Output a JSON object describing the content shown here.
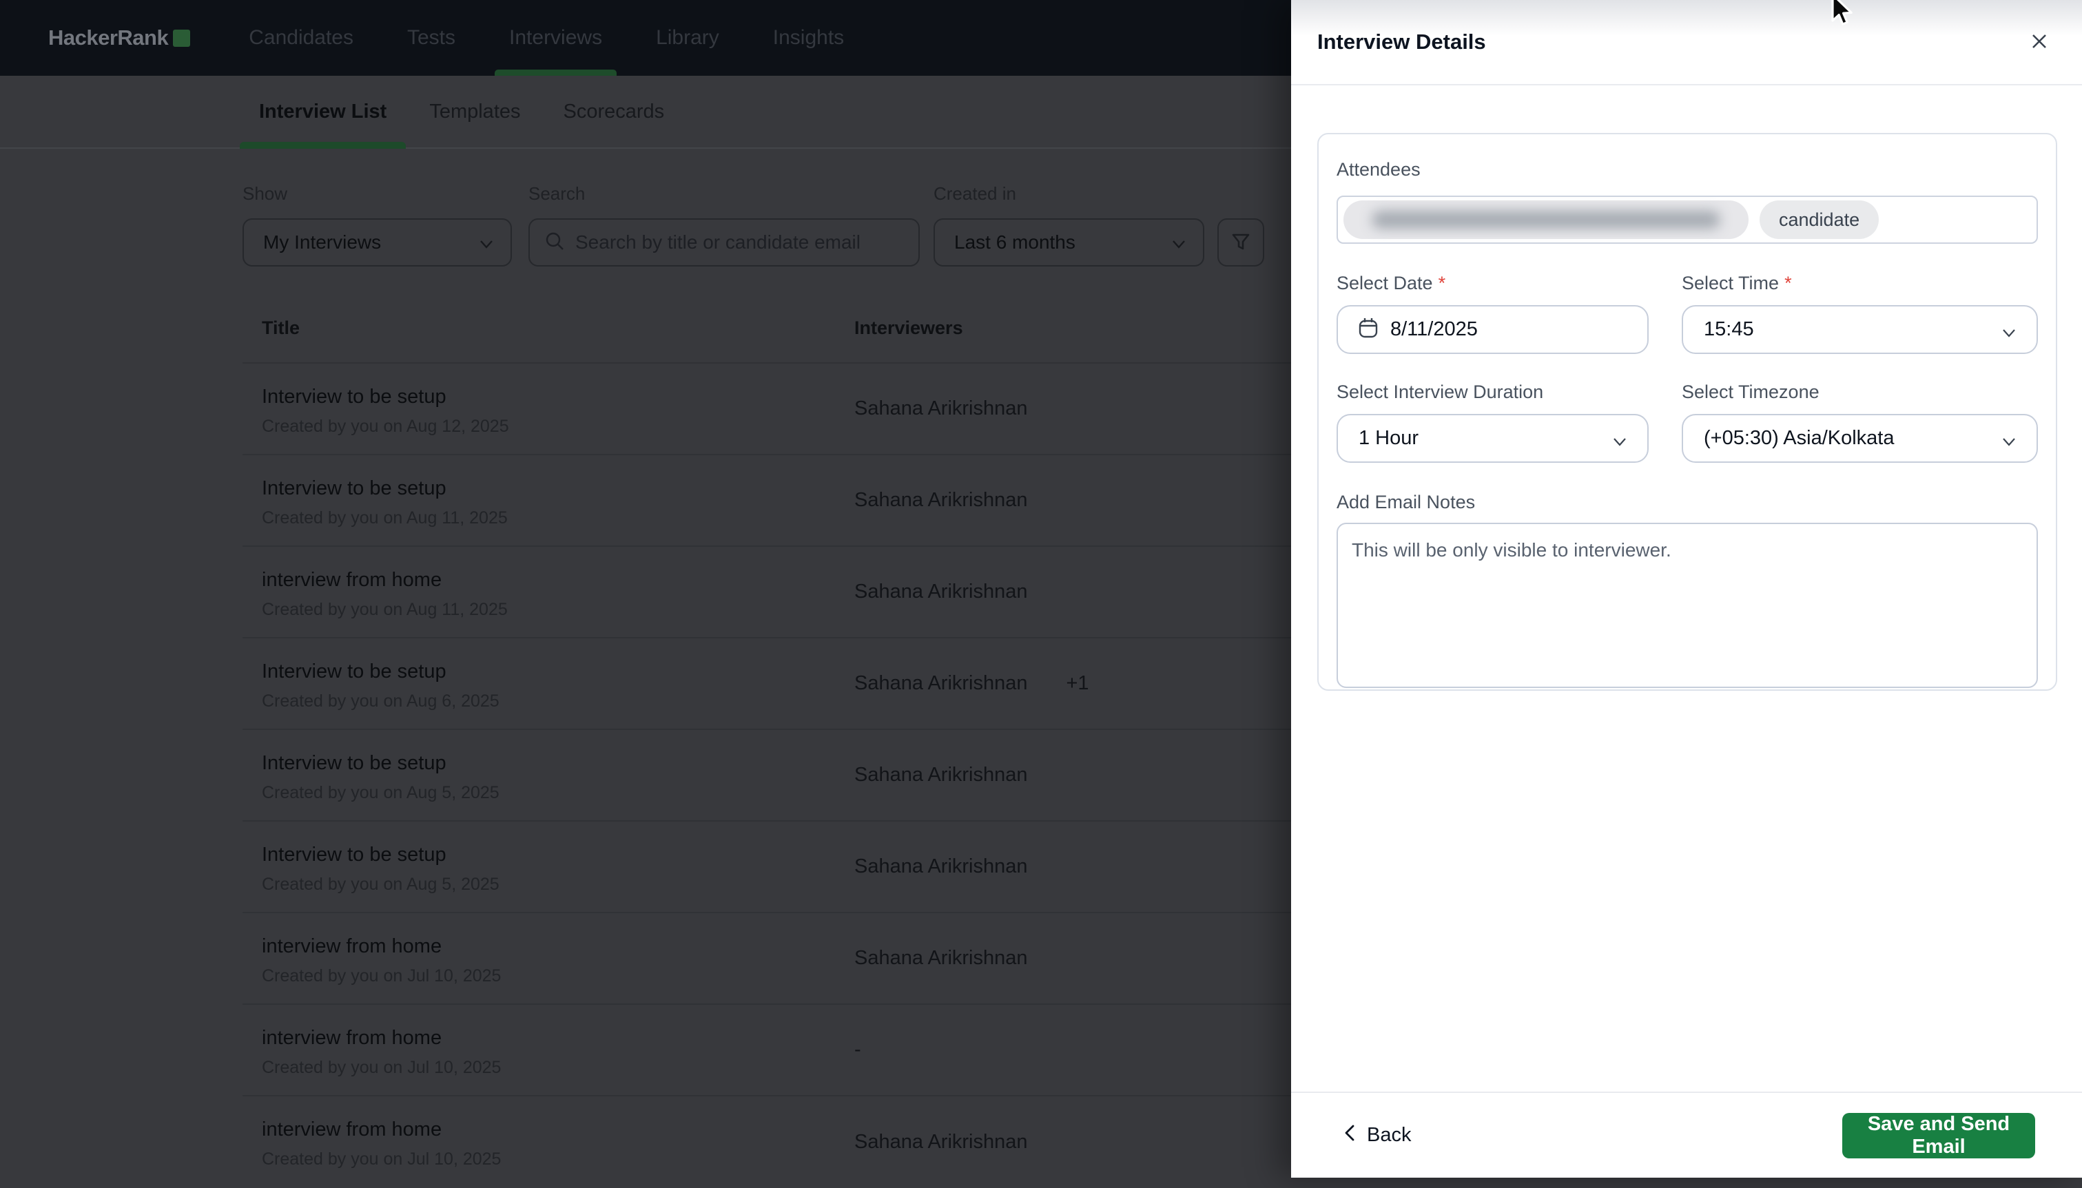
{
  "colors": {
    "brand_green": "#1ba94c",
    "save_button_green": "#188042",
    "required_red": "#e0443b",
    "navbar_bg": "#0d1117",
    "drawer_bg": "#ffffff"
  },
  "nav": {
    "logo_text": "HackerRank",
    "logo_icon": "green-square",
    "items": [
      {
        "label": "Candidates",
        "active": false
      },
      {
        "label": "Tests",
        "active": false
      },
      {
        "label": "Interviews",
        "active": true
      },
      {
        "label": "Library",
        "active": false
      },
      {
        "label": "Insights",
        "active": false
      }
    ]
  },
  "tabs": [
    {
      "label": "Interview List",
      "active": true
    },
    {
      "label": "Templates",
      "active": false
    },
    {
      "label": "Scorecards",
      "active": false
    }
  ],
  "filters": {
    "show": {
      "label": "Show",
      "value": "My Interviews"
    },
    "search": {
      "label": "Search",
      "placeholder": "Search by title or candidate email",
      "icon": "search-icon"
    },
    "created_in": {
      "label": "Created in",
      "value": "Last 6 months"
    },
    "filter_button_icon": "funnel-icon"
  },
  "table": {
    "columns": {
      "title": "Title",
      "interviewers": "Interviewers"
    },
    "rows": [
      {
        "title": "Interview to be setup",
        "created": "Created by you on Aug 12, 2025",
        "interviewer": "Sahana Arikrishnan",
        "extra": ""
      },
      {
        "title": "Interview to be setup",
        "created": "Created by you on Aug 11, 2025",
        "interviewer": "Sahana Arikrishnan",
        "extra": ""
      },
      {
        "title": "interview from home",
        "created": "Created by you on Aug 11, 2025",
        "interviewer": "Sahana Arikrishnan",
        "extra": ""
      },
      {
        "title": "Interview to be setup",
        "created": "Created by you on Aug 6, 2025",
        "interviewer": "Sahana Arikrishnan",
        "extra": "+1"
      },
      {
        "title": "Interview to be setup",
        "created": "Created by you on Aug 5, 2025",
        "interviewer": "Sahana Arikrishnan",
        "extra": ""
      },
      {
        "title": "Interview to be setup",
        "created": "Created by you on Aug 5, 2025",
        "interviewer": "Sahana Arikrishnan",
        "extra": ""
      },
      {
        "title": "interview from home",
        "created": "Created by you on Jul 10, 2025",
        "interviewer": "Sahana Arikrishnan",
        "extra": ""
      },
      {
        "title": "interview from home",
        "created": "Created by you on Jul 10, 2025",
        "interviewer": "-",
        "extra": ""
      },
      {
        "title": "interview from home",
        "created": "Created by you on Jul 10, 2025",
        "interviewer": "Sahana Arikrishnan",
        "extra": ""
      }
    ]
  },
  "drawer": {
    "title": "Interview Details",
    "close_icon": "close-icon",
    "required_marker": "*",
    "attendees": {
      "label": "Attendees",
      "chips": [
        {
          "type": "email",
          "blurred": true,
          "label": ""
        },
        {
          "type": "tag",
          "label": "candidate"
        }
      ]
    },
    "date": {
      "label": "Select Date",
      "required": true,
      "value": "8/11/2025",
      "icon": "calendar-icon"
    },
    "time": {
      "label": "Select Time",
      "required": true,
      "value": "15:45",
      "icon": "chevron-down-icon"
    },
    "duration": {
      "label": "Select Interview Duration",
      "value": "1 Hour",
      "icon": "chevron-down-icon"
    },
    "timezone": {
      "label": "Select Timezone",
      "value": "(+05:30) Asia/Kolkata",
      "icon": "chevron-down-icon"
    },
    "notes": {
      "label": "Add Email Notes",
      "value": "",
      "placeholder": "This will be only visible to interviewer."
    },
    "footer": {
      "back_label": "Back",
      "back_icon": "chevron-left-icon",
      "save_label": "Save and Send Email"
    }
  },
  "cursor": {
    "visible": true,
    "type": "arrow"
  }
}
